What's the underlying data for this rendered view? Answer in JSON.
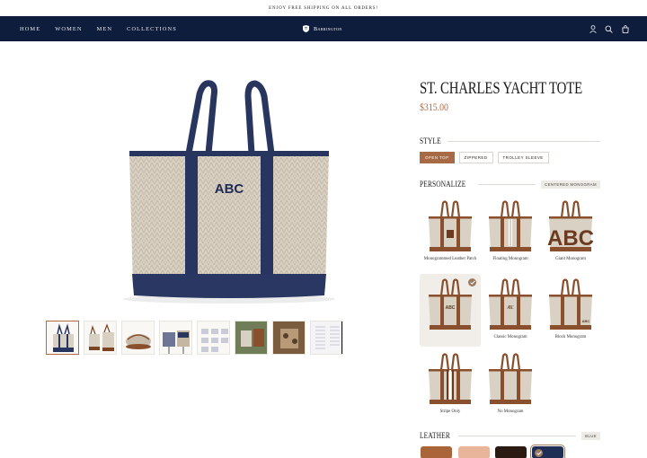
{
  "announcement": "ENJOY FREE SHIPPING ON ALL ORDERS!",
  "nav": {
    "links": [
      "HOME",
      "WOMEN",
      "MEN",
      "COLLECTIONS"
    ],
    "brand": "Barrington",
    "icons": [
      "account-icon",
      "search-icon",
      "bag-icon"
    ]
  },
  "product": {
    "title": "ST. CHARLES YACHT TOTE",
    "price": "$315.00",
    "monogram": "ABC"
  },
  "style": {
    "label": "STYLE",
    "options": [
      "OPEN TOP",
      "ZIPPERED",
      "TROLLEY SLEEVE"
    ],
    "selected": "OPEN TOP"
  },
  "personalize": {
    "label": "PERSONALIZE",
    "tag": "CENTERED MONOGRAM",
    "options": [
      "Monogrammed Leather Patch",
      "Floating Monogram",
      "Giant Monogram",
      "Centered Monogram",
      "Classic Monogram",
      "Block Monogram",
      "Stripe Only",
      "No Monogram"
    ],
    "selected": "Centered Monogram"
  },
  "leather": {
    "label": "LEATHER",
    "tag": "BLUE",
    "swatches": [
      {
        "name": "tan",
        "color": "#a9643a"
      },
      {
        "name": "blush",
        "color": "#e8b49a"
      },
      {
        "name": "dark-brown",
        "color": "#2a1a12"
      },
      {
        "name": "blue",
        "color": "#1f2e55"
      }
    ],
    "selected": "blue"
  },
  "colors": {
    "navy": "#0f1d3d",
    "accent": "#b26a3f",
    "canvas": "#d9d1c4",
    "leather": "#8a4f2c",
    "bag_navy": "#28355e"
  }
}
